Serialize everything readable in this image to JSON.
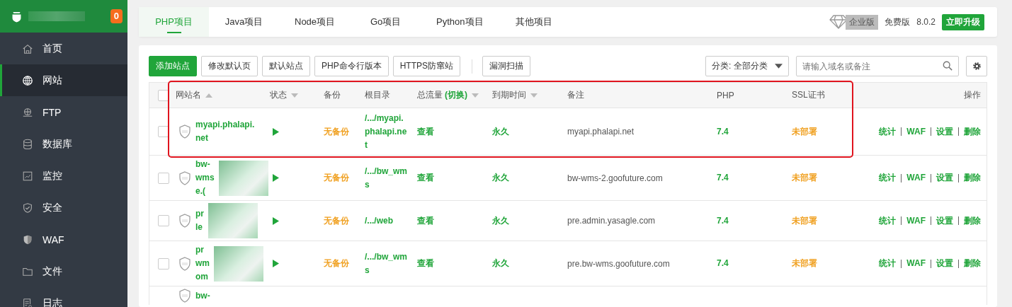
{
  "sidebar": {
    "badge": "0",
    "items": [
      {
        "label": "首页",
        "selected": false
      },
      {
        "label": "网站",
        "selected": true
      },
      {
        "label": "FTP",
        "selected": false
      },
      {
        "label": "数据库",
        "selected": false
      },
      {
        "label": "监控",
        "selected": false
      },
      {
        "label": "安全",
        "selected": false
      },
      {
        "label": "WAF",
        "selected": false
      },
      {
        "label": "文件",
        "selected": false
      },
      {
        "label": "日志",
        "selected": false
      }
    ]
  },
  "tabs": [
    {
      "label": "PHP项目",
      "selected": true
    },
    {
      "label": "Java项目",
      "selected": false
    },
    {
      "label": "Node项目",
      "selected": false
    },
    {
      "label": "Go项目",
      "selected": false
    },
    {
      "label": "Python项目",
      "selected": false
    },
    {
      "label": "其他项目",
      "selected": false
    }
  ],
  "edition": {
    "enterprise": "企业版",
    "free": "免费版",
    "version": "8.0.2",
    "upgrade": "立即升级"
  },
  "toolbar": {
    "buttons": [
      {
        "label": "添加站点",
        "kind": "primary"
      },
      {
        "label": "修改默认页",
        "kind": "default"
      },
      {
        "label": "默认站点",
        "kind": "default"
      },
      {
        "label": "PHP命令行版本",
        "kind": "default"
      },
      {
        "label": "HTTPS防窜站",
        "kind": "default"
      },
      {
        "label": "漏洞扫描",
        "kind": "separated"
      }
    ],
    "category": "分类: 全部分类",
    "search": {
      "placeholder": "请输入域名或备注"
    }
  },
  "table": {
    "select_all_checked": false,
    "columns": [
      {
        "label": "网站名",
        "sort_ascending": true
      },
      {
        "label": "状态",
        "sort_ascending": false
      },
      {
        "label": "备份"
      },
      {
        "label": "根目录"
      },
      {
        "label": "总流量",
        "toggle": "(切换)",
        "sort_ascending": false
      },
      {
        "label": "到期时间",
        "sort_ascending": false
      },
      {
        "label": "备注"
      },
      {
        "label": "PHP"
      },
      {
        "label": "SSL证书"
      },
      {
        "label": "操作"
      }
    ],
    "rows": [
      {
        "checked": false,
        "name": "myapi.phalapi.net",
        "redacted": false,
        "backup": "无备份",
        "root": "/.../myapi.phalapi.net",
        "traffic": "查看",
        "expiry": "永久",
        "note": "myapi.phalapi.net",
        "php": "7.4",
        "ssl": "未部署",
        "actions": [
          "统计",
          "WAF",
          "设置",
          "删除"
        ]
      },
      {
        "checked": false,
        "name": "bw-wms e.(",
        "redacted": true,
        "backup": "无备份",
        "root": "/.../bw_wms",
        "traffic": "查看",
        "expiry": "永久",
        "note": "bw-wms-2.goofuture.com",
        "php": "7.4",
        "ssl": "未部署",
        "actions": [
          "统计",
          "WAF",
          "设置",
          "删除"
        ]
      },
      {
        "checked": false,
        "name": "pr le",
        "redacted": true,
        "backup": "无备份",
        "root": "/.../web",
        "traffic": "查看",
        "expiry": "永久",
        "note": "pre.admin.yasagle.com",
        "php": "7.4",
        "ssl": "未部署",
        "actions": [
          "统计",
          "WAF",
          "设置",
          "删除"
        ]
      },
      {
        "checked": false,
        "name": "pr wm om",
        "redacted": true,
        "backup": "无备份",
        "root": "/.../bw_wms",
        "traffic": "查看",
        "expiry": "永久",
        "note": "pre.bw-wms.goofuture.com",
        "php": "7.4",
        "ssl": "未部署",
        "actions": [
          "统计",
          "WAF",
          "设置",
          "删除"
        ]
      },
      {
        "name": "bw-",
        "redacted": false
      }
    ]
  }
}
